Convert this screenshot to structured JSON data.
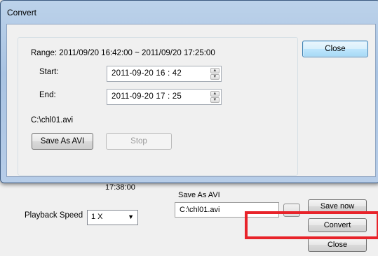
{
  "background": {
    "time": "17:38:00",
    "playback_speed_label": "Playback Speed",
    "playback_speed_value": "1 X",
    "save_as_avi_label": "Save As AVI",
    "save_path": "C:\\chl01.avi",
    "save_now_label": "Save now",
    "convert_label": "Convert",
    "close_label": "Close"
  },
  "dialog": {
    "title": "Convert",
    "range": "Range: 2011/09/20 16:42:00 ~ 2011/09/20 17:25:00",
    "start_label": "Start:",
    "start_value": "2011-09-20  16 : 42",
    "end_label": "End:",
    "end_value": "2011-09-20  17 : 25",
    "file_path": "C:\\chl01.avi",
    "save_as_avi_label": "Save As AVI",
    "stop_label": "Stop",
    "close_label": "Close"
  },
  "colors": {
    "highlight": "#e8232a",
    "dialog_frame": "#a9c3e2"
  }
}
